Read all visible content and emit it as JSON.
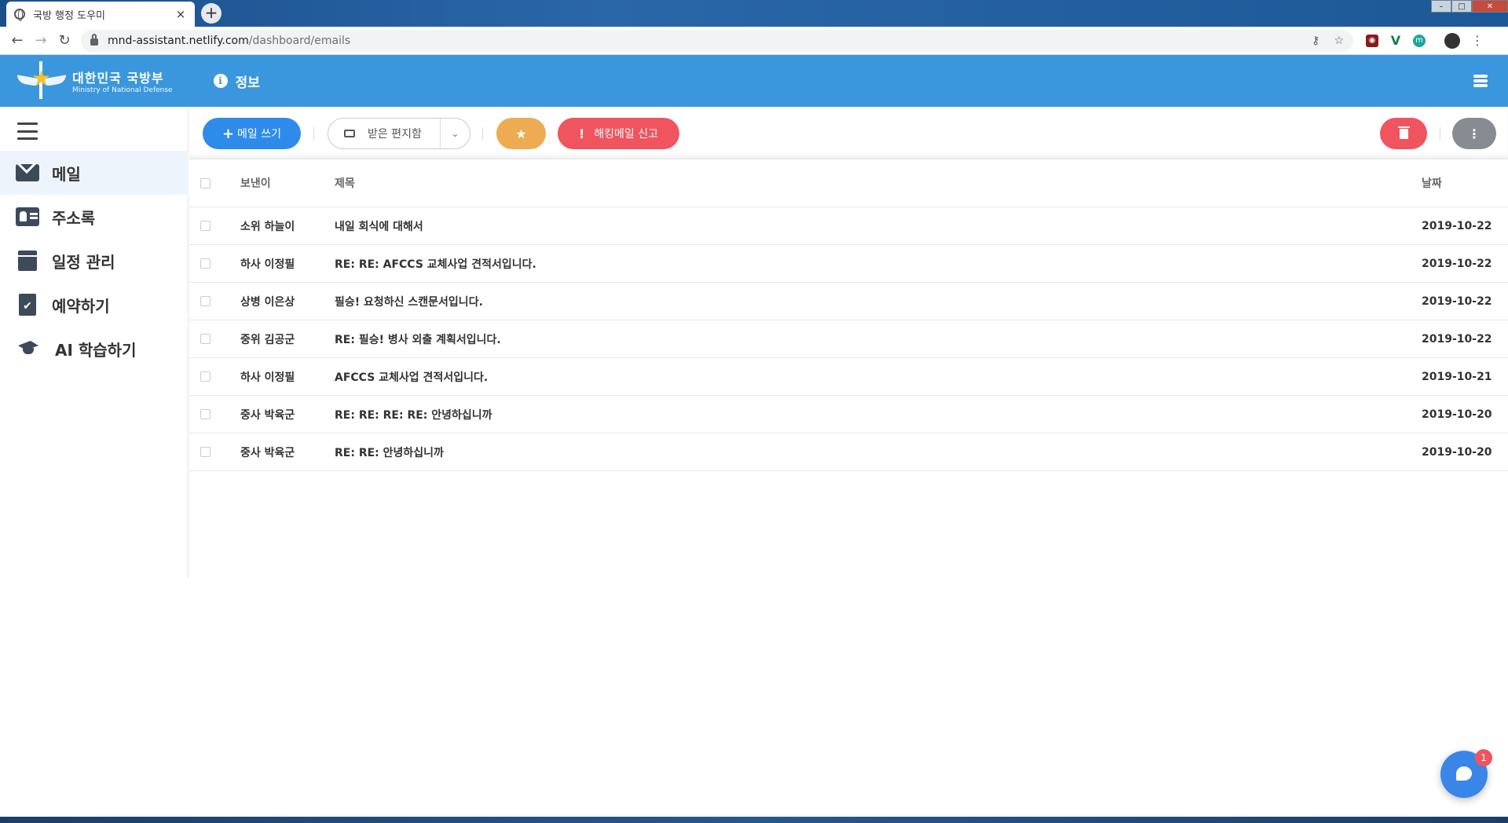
{
  "browser": {
    "tab_title": "국방 행정 도우미",
    "tab_close": "×",
    "new_tab": "+",
    "url_host": "mnd-assistant.netlify.com",
    "url_path": "/dashboard/emails",
    "back": "←",
    "forward": "→",
    "reload": "↻",
    "key_icon": "⚷",
    "star_icon": "☆",
    "menu_icon": "⋮",
    "window_min": "–",
    "window_max": "□",
    "window_close": "✕",
    "ext_ublock": "◉",
    "ext_vue": "V",
    "ext_m": "m"
  },
  "header": {
    "logo_ko": "대한민국 국방부",
    "logo_en": "Ministry of National Defense",
    "info_label": "정보",
    "info_icon": "i",
    "accent_color": "#3a97dd"
  },
  "sidebar": {
    "items": [
      {
        "label": "메일",
        "icon": "envelope-icon",
        "active": true
      },
      {
        "label": "주소록",
        "icon": "address-card-icon",
        "active": false
      },
      {
        "label": "일정 관리",
        "icon": "calendar-icon",
        "active": false
      },
      {
        "label": "예약하기",
        "icon": "clipboard-check-icon",
        "active": false
      },
      {
        "label": "AI 학습하기",
        "icon": "graduation-cap-icon",
        "active": false
      }
    ],
    "clip_check": "✔"
  },
  "toolbar": {
    "compose_plus": "+",
    "compose_label": "메일 쓰기",
    "mailbox_label": "받은 편지함",
    "caret": "⌄",
    "star": "★",
    "report_excl": "!",
    "report_label": "해킹메일 신고",
    "more": "⋮",
    "compose_color": "#2f8bea",
    "star_color": "#eeac52",
    "danger_color": "#f0545f"
  },
  "table": {
    "headers": {
      "sender": "보낸이",
      "subject": "제목",
      "date": "날짜"
    },
    "rows": [
      {
        "sender": "소위 하늘이",
        "subject": "내일 회식에 대해서",
        "date": "2019-10-22"
      },
      {
        "sender": "하사 이정필",
        "subject": "RE: RE: AFCCS 교체사업 견적서입니다.",
        "date": "2019-10-22"
      },
      {
        "sender": "상병 이은상",
        "subject": "필승! 요청하신 스캔문서입니다.",
        "date": "2019-10-22"
      },
      {
        "sender": "중위 김공군",
        "subject": "RE: 필승! 병사 외출 계획서입니다.",
        "date": "2019-10-22"
      },
      {
        "sender": "하사 이정필",
        "subject": "AFCCS 교체사업 견적서입니다.",
        "date": "2019-10-21"
      },
      {
        "sender": "중사 박육군",
        "subject": "RE: RE: RE: RE: 안녕하십니까",
        "date": "2019-10-20"
      },
      {
        "sender": "중사 박육군",
        "subject": "RE: RE: 안녕하십니까",
        "date": "2019-10-20"
      }
    ]
  },
  "chat": {
    "badge": "1"
  }
}
